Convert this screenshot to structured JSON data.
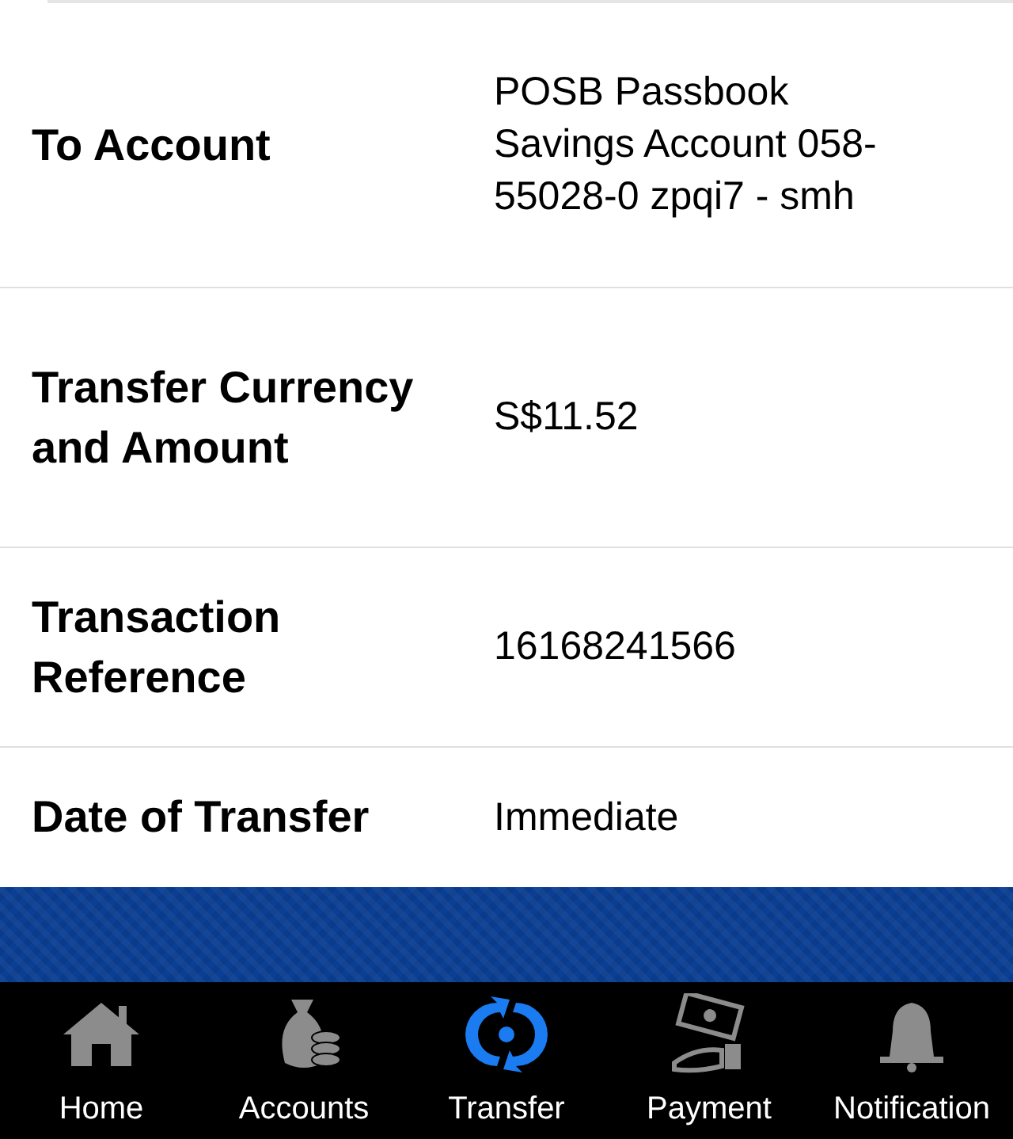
{
  "details": [
    {
      "label": "To Account",
      "value": "POSB Passbook Savings Account 058-55028-0 zpqi7 - smh"
    },
    {
      "label": "Transfer Currency and Amount",
      "value": "S$11.52"
    },
    {
      "label": "Transaction Reference",
      "value": "16168241566"
    },
    {
      "label": "Date of Transfer",
      "value": "Immediate"
    }
  ],
  "tab_bar": [
    {
      "label": "Home",
      "kind": "home",
      "selected": false
    },
    {
      "label": "Accounts",
      "kind": "money",
      "selected": false
    },
    {
      "label": "Transfer",
      "kind": "transfer",
      "selected": true
    },
    {
      "label": "Payment",
      "kind": "payment",
      "selected": false
    },
    {
      "label": "Notification",
      "kind": "bell",
      "selected": false
    }
  ]
}
